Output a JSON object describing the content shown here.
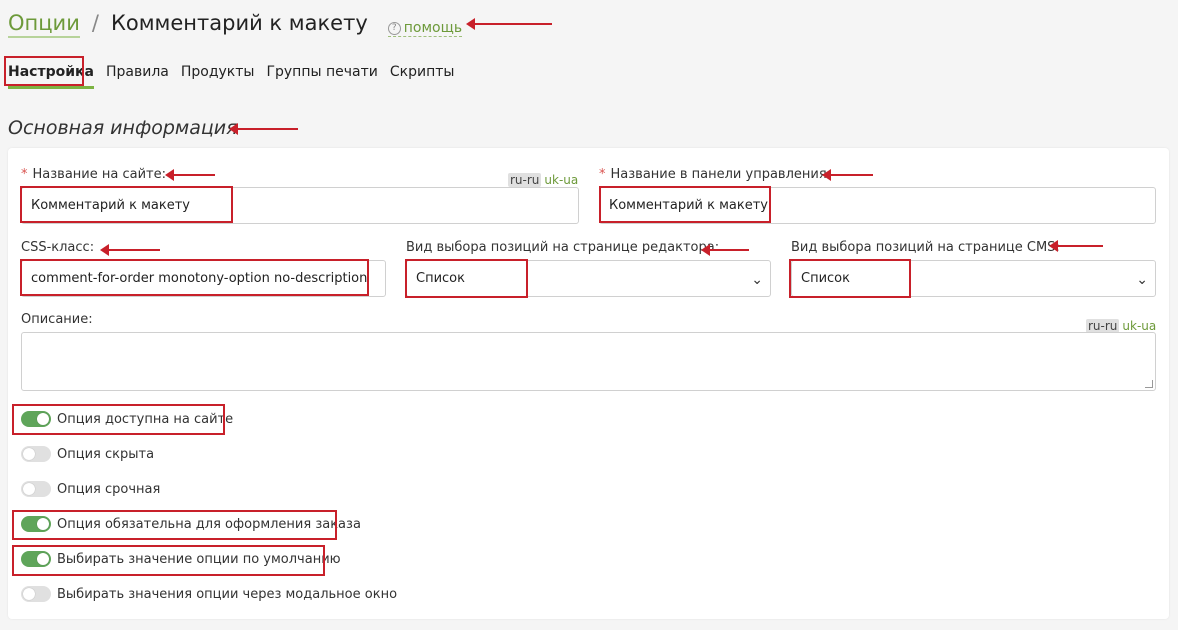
{
  "breadcrumb": {
    "parent": "Опции",
    "separator": "/",
    "current": "Комментарий к макету",
    "help_label": "помощь",
    "help_icon": "?"
  },
  "tabs": [
    {
      "label": "Настройка",
      "active": true
    },
    {
      "label": "Правила",
      "active": false
    },
    {
      "label": "Продукты",
      "active": false
    },
    {
      "label": "Группы печати",
      "active": false
    },
    {
      "label": "Скрипты",
      "active": false
    }
  ],
  "section_title": "Основная информация",
  "form": {
    "required_mark": "*",
    "site_name": {
      "label": "Название на сайте:",
      "value": "Комментарий к макету"
    },
    "admin_name": {
      "label": "Название в панели управления:",
      "value": "Комментарий к макету"
    },
    "css_class": {
      "label": "CSS-класс:",
      "value": "comment-for-order monotony-option no-description"
    },
    "editor_select": {
      "label": "Вид выбора позиций на странице редактора:",
      "value": "Список"
    },
    "cms_select": {
      "label": "Вид выбора позиций на странице CMS:",
      "value": "Список"
    },
    "description": {
      "label": "Описание:",
      "value": ""
    },
    "lang": {
      "active": "ru-ru",
      "other": "uk-ua"
    }
  },
  "toggles": [
    {
      "label": "Опция доступна на сайте",
      "on": true
    },
    {
      "label": "Опция скрыта",
      "on": false
    },
    {
      "label": "Опция срочная",
      "on": false
    },
    {
      "label": "Опция обязательна для оформления заказа",
      "on": true
    },
    {
      "label": "Выбирать значение опции по умолчанию",
      "on": true
    },
    {
      "label": "Выбирать значения опции через модальное окно",
      "on": false
    }
  ],
  "colors": {
    "accent": "#6d9a3a",
    "toggle_on": "#5fa55a",
    "annotation": "#c8202a"
  }
}
